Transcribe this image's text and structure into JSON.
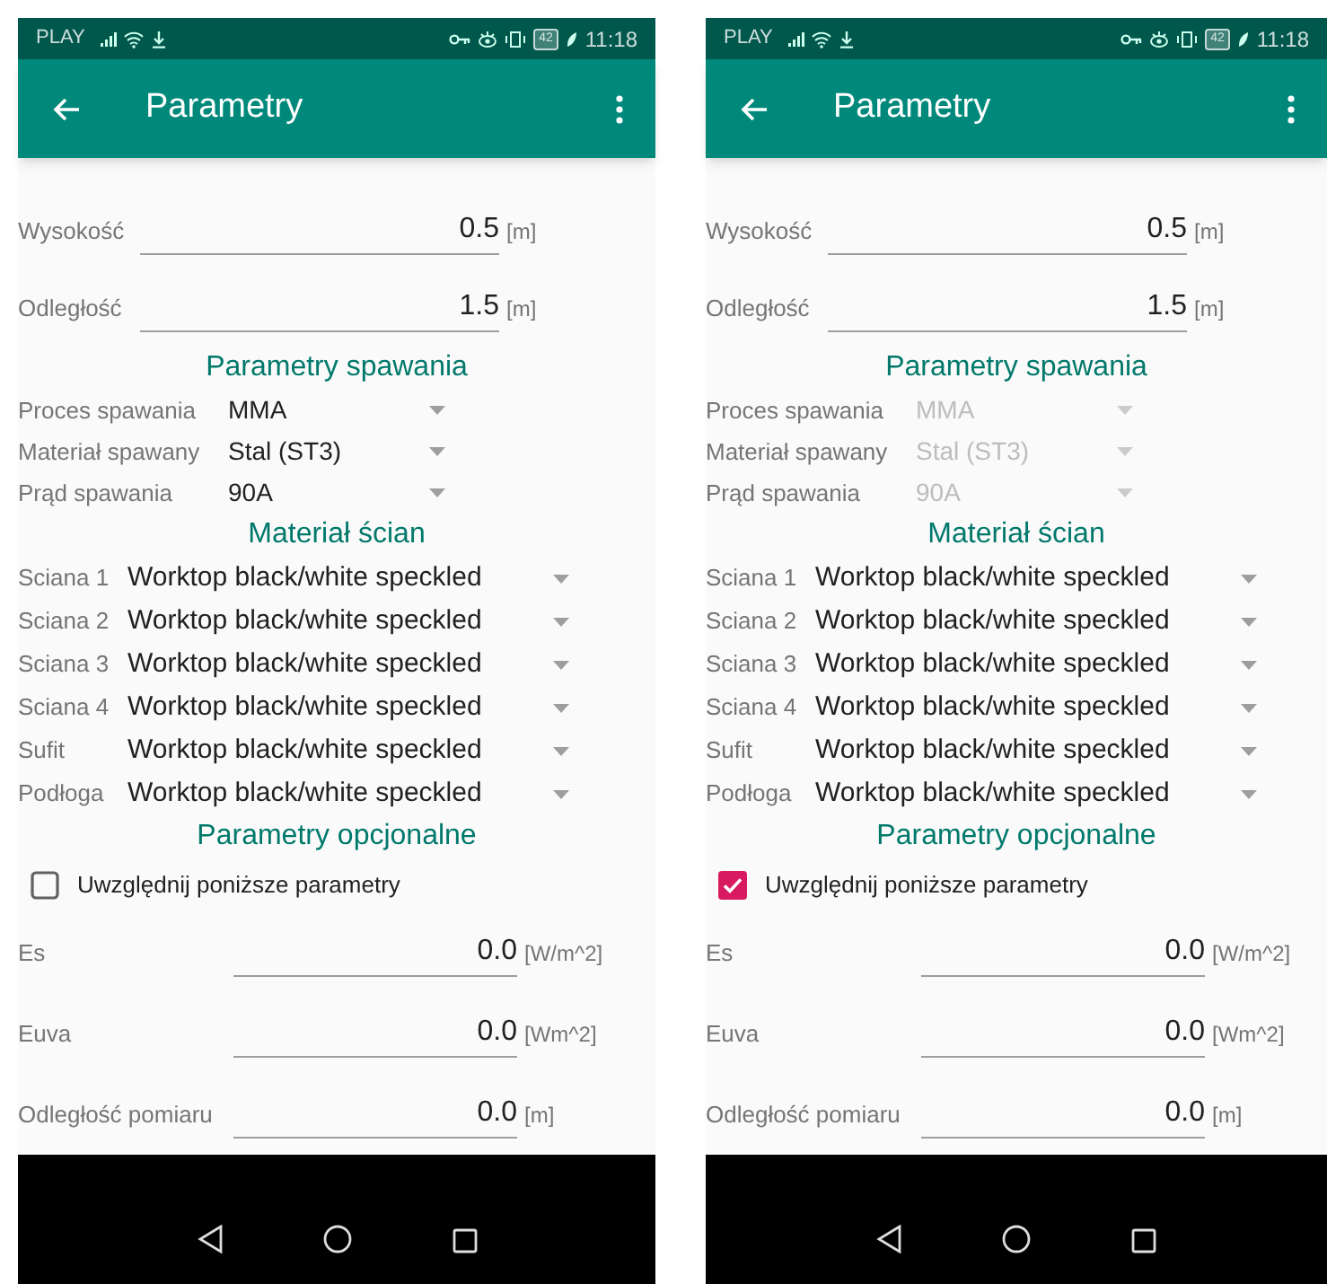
{
  "screens": [
    {
      "status_bar": {
        "carrier": "PLAY",
        "battery": "42",
        "time": "11:18"
      },
      "title": "Parametry",
      "top_fields": [
        {
          "label": "Wysokość",
          "value": "0.5",
          "unit": "[m]"
        },
        {
          "label": "Odległość",
          "value": "1.5",
          "unit": "[m]"
        }
      ],
      "welding": {
        "heading": "Parametry spawania",
        "rows": [
          {
            "label": "Proces spawania",
            "value": "MMA",
            "disabled": false
          },
          {
            "label": "Materiał spawany",
            "value": "Stal (ST3)",
            "disabled": false
          },
          {
            "label": "Prąd spawania",
            "value": "90A",
            "disabled": false
          }
        ]
      },
      "walls": {
        "heading": "Materiał ścian",
        "rows": [
          {
            "label": "Sciana 1",
            "value": "Worktop black/white speckled"
          },
          {
            "label": "Sciana 2",
            "value": "Worktop black/white speckled"
          },
          {
            "label": "Sciana 3",
            "value": "Worktop black/white speckled"
          },
          {
            "label": "Sciana 4",
            "value": "Worktop black/white speckled"
          },
          {
            "label": "Sufit",
            "value": "Worktop black/white speckled"
          },
          {
            "label": "Podłoga",
            "value": "Worktop black/white speckled"
          }
        ]
      },
      "optional": {
        "heading": "Parametry opcjonalne",
        "checkbox": {
          "label": "Uwzględnij poniższe parametry",
          "checked": false
        },
        "fields": [
          {
            "label": "Es",
            "value": "0.0",
            "unit": "[W/m^2]"
          },
          {
            "label": "Euva",
            "value": "0.0",
            "unit": "[Wm^2]"
          },
          {
            "label": "Odległość pomiaru",
            "value": "0.0",
            "unit": "[m]"
          }
        ]
      }
    },
    {
      "status_bar": {
        "carrier": "PLAY",
        "battery": "42",
        "time": "11:18"
      },
      "title": "Parametry",
      "top_fields": [
        {
          "label": "Wysokość",
          "value": "0.5",
          "unit": "[m]"
        },
        {
          "label": "Odległość",
          "value": "1.5",
          "unit": "[m]"
        }
      ],
      "welding": {
        "heading": "Parametry spawania",
        "rows": [
          {
            "label": "Proces spawania",
            "value": "MMA",
            "disabled": true
          },
          {
            "label": "Materiał spawany",
            "value": "Stal (ST3)",
            "disabled": true
          },
          {
            "label": "Prąd spawania",
            "value": "90A",
            "disabled": true
          }
        ]
      },
      "walls": {
        "heading": "Materiał ścian",
        "rows": [
          {
            "label": "Sciana 1",
            "value": "Worktop black/white speckled"
          },
          {
            "label": "Sciana 2",
            "value": "Worktop black/white speckled"
          },
          {
            "label": "Sciana 3",
            "value": "Worktop black/white speckled"
          },
          {
            "label": "Sciana 4",
            "value": "Worktop black/white speckled"
          },
          {
            "label": "Sufit",
            "value": "Worktop black/white speckled"
          },
          {
            "label": "Podłoga",
            "value": "Worktop black/white speckled"
          }
        ]
      },
      "optional": {
        "heading": "Parametry opcjonalne",
        "checkbox": {
          "label": "Uwzględnij poniższe parametry",
          "checked": true
        },
        "fields": [
          {
            "label": "Es",
            "value": "0.0",
            "unit": "[W/m^2]"
          },
          {
            "label": "Euva",
            "value": "0.0",
            "unit": "[Wm^2]"
          },
          {
            "label": "Odległość pomiaru",
            "value": "0.0",
            "unit": "[m]"
          }
        ]
      }
    }
  ]
}
